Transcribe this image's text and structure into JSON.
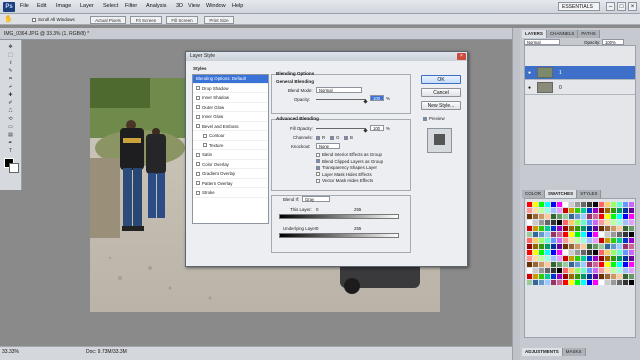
{
  "app": {
    "logo": "Ps",
    "workspace": "ESSENTIALS"
  },
  "menu": [
    "File",
    "Edit",
    "Image",
    "Layer",
    "Select",
    "Filter",
    "Analysis",
    "3D",
    "View",
    "Window",
    "Help"
  ],
  "window_buttons": [
    "–",
    "□",
    "×"
  ],
  "options_bar": {
    "scroll_all": "Scroll All Windows",
    "actual_pixels": "Actual Pixels",
    "fit_screen": "Fit Screen",
    "fill_screen": "Fill Screen",
    "print_size": "Print Size"
  },
  "document": {
    "tab_title": "IMG_0364.JPG @ 33.3% (1, RGB/8) *",
    "zoom": "33.33%",
    "doc_info": "Doc: 9.73M/33.3M"
  },
  "layers_panel": {
    "tabs": [
      "LAYERS",
      "CHANNELS",
      "PATHS"
    ],
    "blend_mode": "Normal",
    "opacity_label": "Opacity:",
    "opacity_value": "100%",
    "layers": [
      {
        "name": "1"
      },
      {
        "name": "0"
      }
    ]
  },
  "swatches_panel": {
    "tabs": [
      "COLOR",
      "SWATCHES",
      "STYLES"
    ]
  },
  "adjust_panel": {
    "tabs": [
      "ADJUSTMENTS",
      "MASKS"
    ]
  },
  "dialog": {
    "title": "Layer Style",
    "styles_header": "Styles",
    "styles": [
      {
        "label": "Blending Options: Default",
        "active": true,
        "check": false
      },
      {
        "label": "Drop Shadow",
        "check": true
      },
      {
        "label": "Inner Shadow",
        "check": true
      },
      {
        "label": "Outer Glow",
        "check": true
      },
      {
        "label": "Inner Glow",
        "check": true
      },
      {
        "label": "Bevel and Emboss",
        "check": true
      },
      {
        "label": "Contour",
        "check": true,
        "indent": true
      },
      {
        "label": "Texture",
        "check": true,
        "indent": true
      },
      {
        "label": "Satin",
        "check": true
      },
      {
        "label": "Color Overlay",
        "check": true
      },
      {
        "label": "Gradient Overlay",
        "check": true
      },
      {
        "label": "Pattern Overlay",
        "check": true
      },
      {
        "label": "Stroke",
        "check": true
      }
    ],
    "blending_options": "Blending Options",
    "general_blending": "General Blending",
    "blend_mode_label": "Blend Mode:",
    "blend_mode_value": "Normal",
    "opacity_label": "Opacity:",
    "opacity_value": "100",
    "percent": "%",
    "advanced_blending": "Advanced Blending",
    "fill_opacity_label": "Fill Opacity:",
    "fill_opacity_value": "100",
    "channels_label": "Channels:",
    "channels": [
      "R",
      "G",
      "B"
    ],
    "knockout_label": "Knockout:",
    "knockout_value": "None",
    "adv_options": [
      {
        "label": "Blend Interior Effects as Group",
        "checked": false
      },
      {
        "label": "Blend Clipped Layers as Group",
        "checked": true
      },
      {
        "label": "Transparency Shapes Layer",
        "checked": true
      },
      {
        "label": "Layer Mask Hides Effects",
        "checked": false
      },
      {
        "label": "Vector Mask Hides Effects",
        "checked": false
      }
    ],
    "blend_if_label": "Blend If:",
    "blend_if_value": "Gray",
    "this_layer_label": "This Layer:",
    "this_layer_min": "0",
    "this_layer_max": "255",
    "underlying_label": "Underlying Layer:",
    "underlying_min": "0",
    "underlying_max": "255",
    "ok": "OK",
    "cancel": "Cancel",
    "new_style": "New Style...",
    "preview": "Preview"
  }
}
